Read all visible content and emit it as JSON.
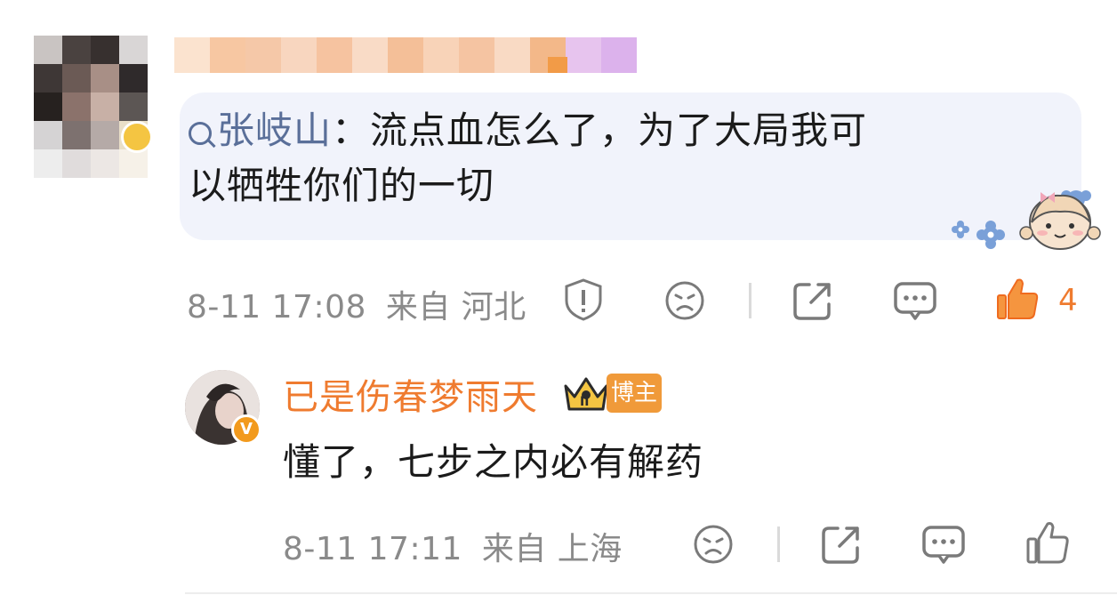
{
  "top_comment": {
    "mention": "张岐山",
    "separator": "：",
    "text_line1": "流点血怎么了，为了大局我可",
    "text_line2": "以牺牲你们的一切",
    "meta": {
      "time": "8-11 17:08",
      "source": "来自 河北"
    },
    "actions": {
      "like_count": "4"
    }
  },
  "reply": {
    "author": "已是伤春梦雨天",
    "badge_label": "博主",
    "crown_level": "II",
    "verify_mark": "V",
    "text": "懂了，七步之内必有解药",
    "meta": {
      "time": "8-11 17:11",
      "source": "来自 上海"
    }
  },
  "colors": {
    "accent_orange": "#ef7b2f",
    "mention_blue": "#5a6f99",
    "bubble_bg": "#f1f3fb",
    "meta_gray": "#8a8a8a"
  },
  "icons": [
    "report-icon",
    "dislike-face-icon",
    "share-icon",
    "comment-icon",
    "like-icon",
    "crown-icon",
    "verified-icon"
  ]
}
